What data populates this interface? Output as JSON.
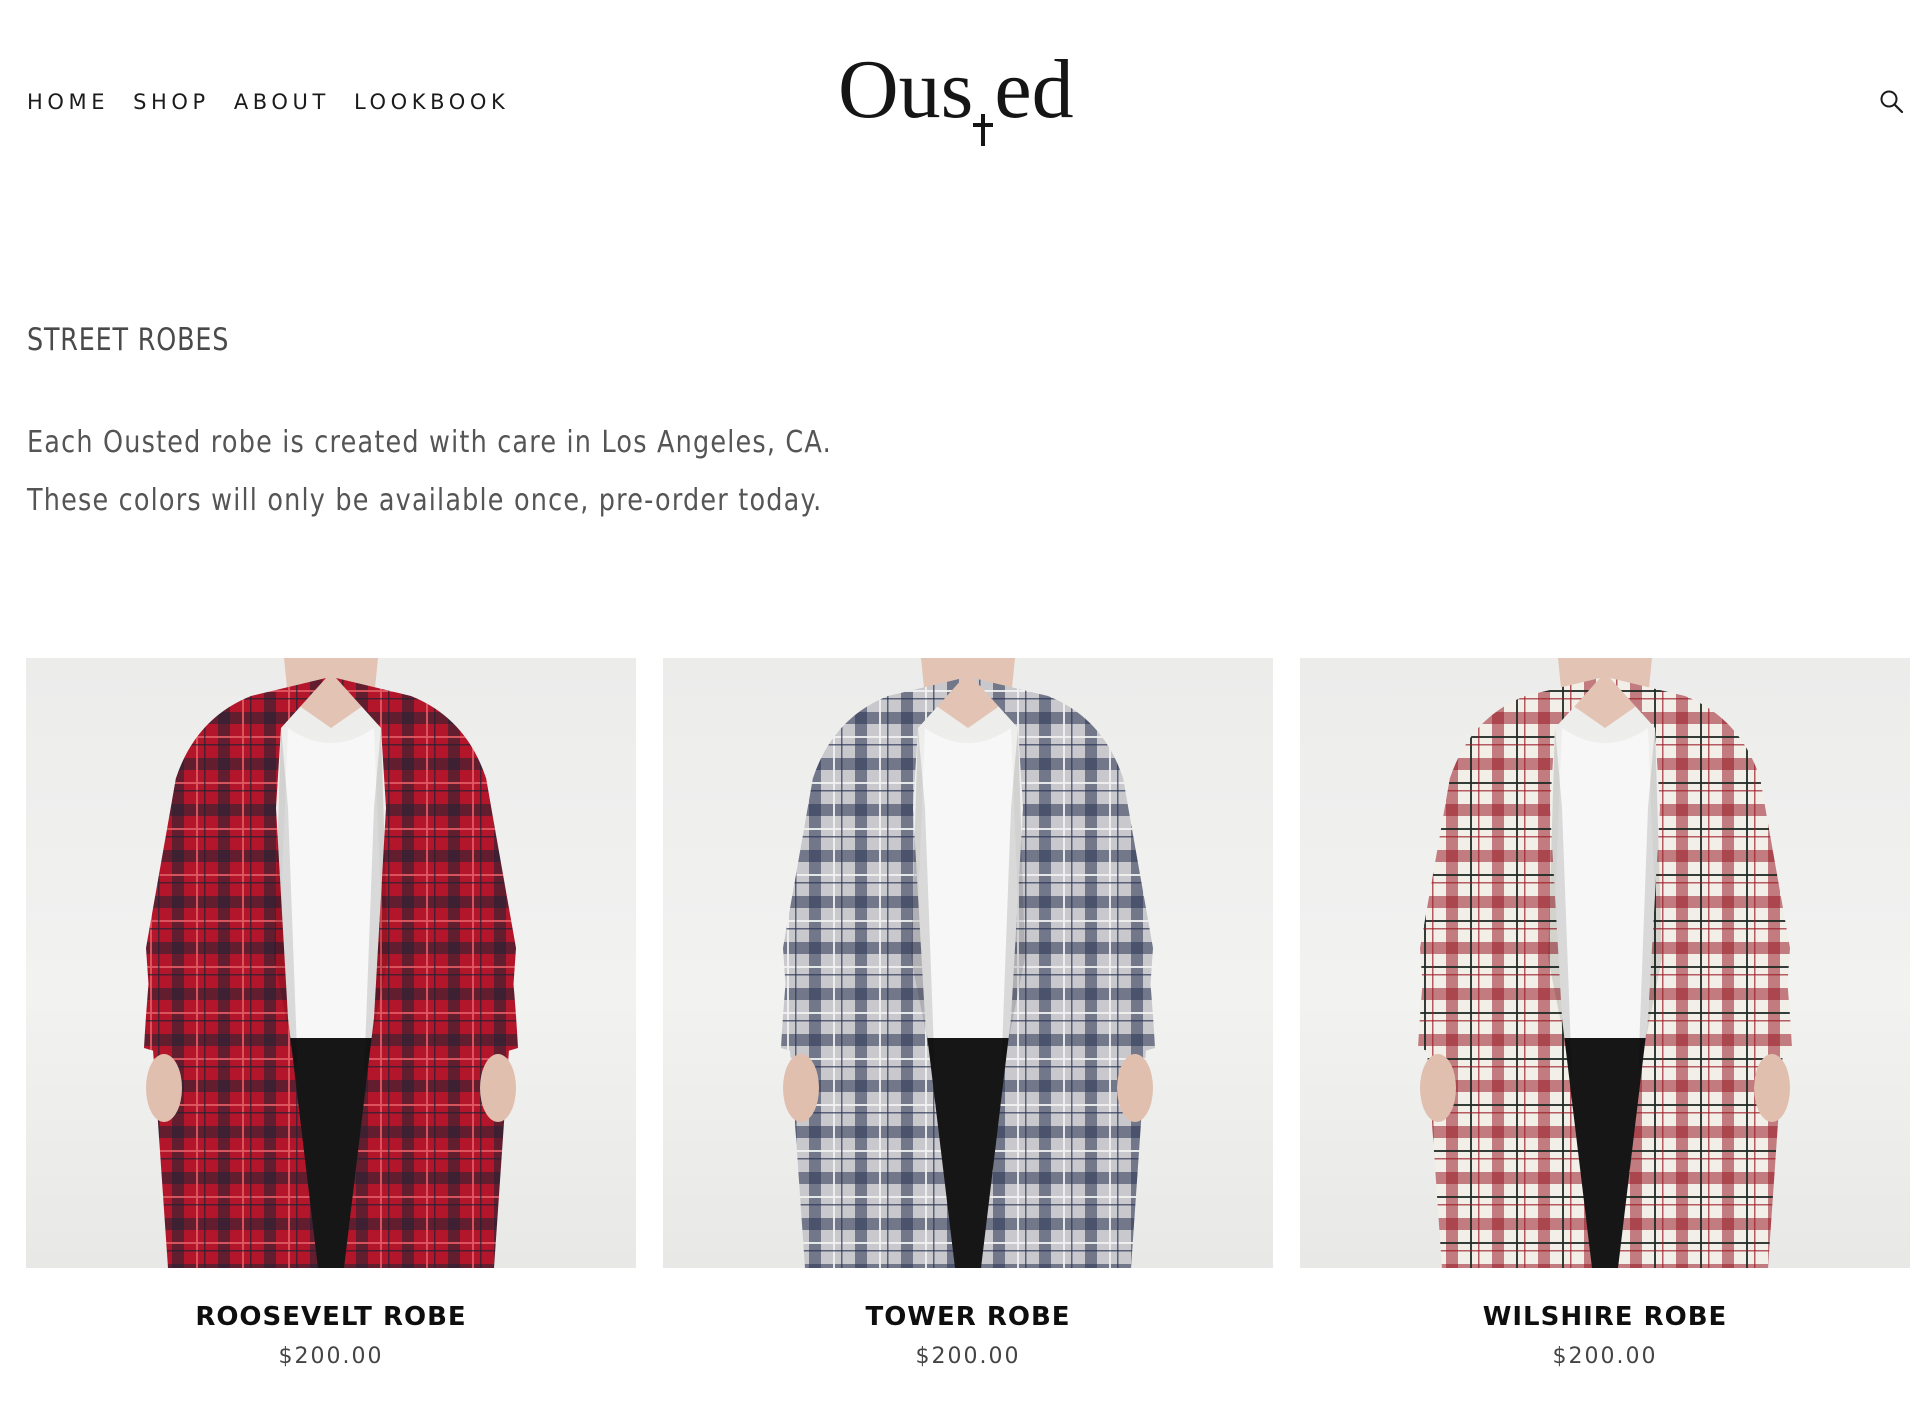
{
  "brand": {
    "logo_text": "Ous ed"
  },
  "nav": {
    "items": [
      {
        "label": "HOME"
      },
      {
        "label": "SHOP"
      },
      {
        "label": "ABOUT"
      },
      {
        "label": "LOOKBOOK"
      }
    ],
    "search_icon": "search-icon"
  },
  "collection": {
    "title": "STREET ROBES",
    "description_lines": [
      "Each Ousted robe is created with care in Los Angeles, CA.",
      "These colors will only be available once, pre-order today."
    ]
  },
  "products": [
    {
      "name": "ROOSEVELT ROBE",
      "price": "$200.00",
      "plaid_base": "#b3162a",
      "plaid_line": "#1f2233",
      "plaid_accent": "#e05a63"
    },
    {
      "name": "TOWER ROBE",
      "price": "$200.00",
      "plaid_base": "#c9c9cd",
      "plaid_line": "#2a3354",
      "plaid_accent": "#f2f2f2"
    },
    {
      "name": "WILSHIRE ROBE",
      "price": "$200.00",
      "plaid_base": "#f1efe8",
      "plaid_line": "#9b1b26",
      "plaid_accent": "#1f2a24"
    }
  ]
}
